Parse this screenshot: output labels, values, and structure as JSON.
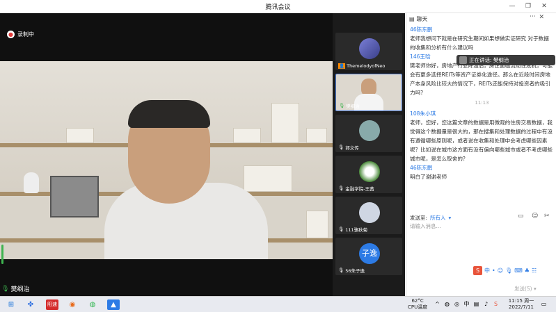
{
  "window": {
    "title": "腾讯会议"
  },
  "recording": {
    "label": "录制中"
  },
  "main_speaker": {
    "name": "樊纲治"
  },
  "thumbnails": [
    {
      "name": "ThemelodyofNeo",
      "kind": "avatar"
    },
    {
      "name": "樊纲治",
      "kind": "video"
    },
    {
      "name": "郭文传",
      "kind": "avatar"
    },
    {
      "name": "金融学院-王茜",
      "kind": "avatar"
    },
    {
      "name": "111骆秋菊",
      "kind": "avatar"
    },
    {
      "name": "56朱子逸",
      "kind": "text-avatar",
      "avatar_text": "子逸"
    }
  ],
  "chat": {
    "header": "聊天",
    "speaking_now": "正在讲话: 樊纲治",
    "messages": [
      {
        "sender": "46陈东鹏",
        "text": "老师我想问下就是在研究生期间如果想做实证研究 对于数据的收集和分析有什么建议吗"
      },
      {
        "sender": "146王晗",
        "text": "樊老师你好，房地产行业降温后，房企面临流动性危机，可能会有更多选择REITs等资产证券化途径。那么在近段时间房地产本身风险比较大的情况下，REITs还能保持对投资者的吸引力吗？"
      },
      {
        "timestamp": "11:13"
      },
      {
        "sender": "108朱小琪",
        "text": "老师，您好，您这篇文章的数据是用微观的住房交易数据，我觉得这个数据量是很大的，那在搜集和处理数据的过程中有没有遵循哪些原则呢，或者说在收集和处理中会考虑哪些因素呢？比如说在城市这方面有没有偏向哪些城市或者不考虑哪些城市呢，是怎么取舍的？"
      },
      {
        "sender": "46陈东鹏",
        "text": "明白了谢谢老师"
      }
    ],
    "send_to_label": "发送至:",
    "send_to_value": "所有人",
    "input_placeholder": "请输入消息...",
    "send_button": "发送(S)"
  },
  "taskbar": {
    "apps": [
      "windows-start",
      "widgets",
      "red-app",
      "firefox",
      "wechat",
      "tencent-meeting"
    ],
    "app_text_red": "阳速",
    "temperature": "62°C",
    "temp_label": "CPU温度",
    "time": "11:15 周一",
    "date": "2022/7/11"
  },
  "colors": {
    "accent": "#2d7be5",
    "recording": "#e03a3a",
    "mic_active": "#3eb34f"
  }
}
